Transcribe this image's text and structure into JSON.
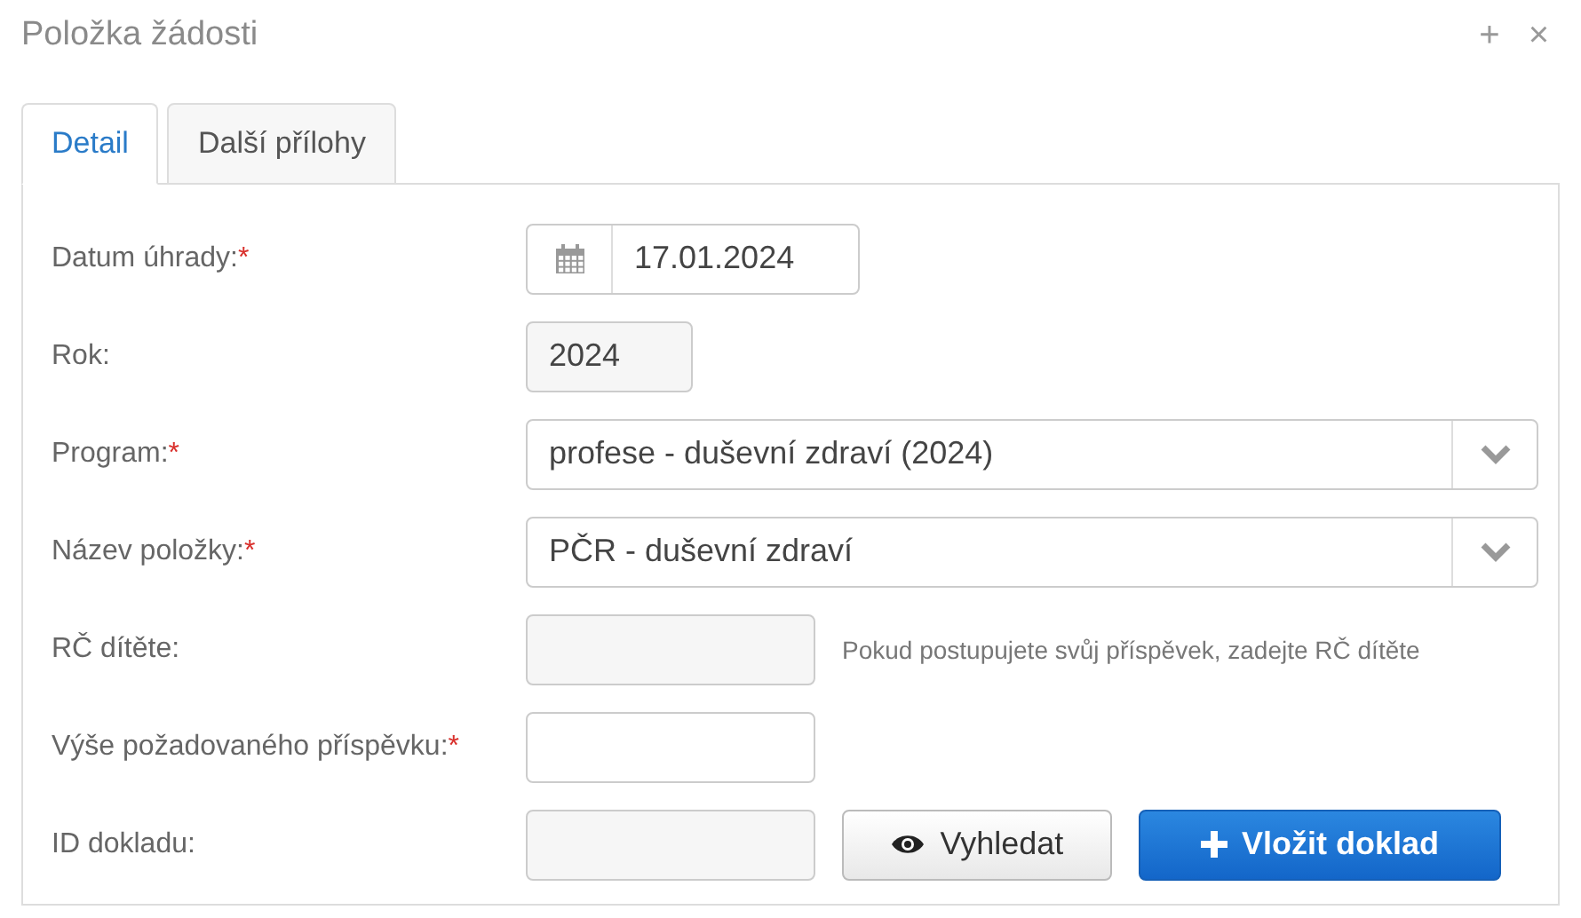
{
  "window": {
    "title": "Položka žádosti",
    "controls": [
      "+",
      "×"
    ]
  },
  "tabs": [
    {
      "label": "Detail",
      "selected": true
    },
    {
      "label": "Další přílohy",
      "selected": false
    }
  ],
  "form": [
    {
      "kind": "date",
      "label": "Datum úhrady:",
      "required_mark": "*",
      "value": "17.01.2024"
    },
    {
      "kind": "year",
      "label": "Rok:",
      "value": "2024"
    },
    {
      "kind": "select",
      "label": "Program:",
      "required_mark": "*",
      "value": "profese - duševní zdraví (2024)"
    },
    {
      "kind": "select",
      "label": "Název položky:",
      "required_mark": "*",
      "value": "PČR - duševní zdraví"
    },
    {
      "kind": "readonly",
      "label": "RČ dítěte:",
      "hint": "Pokud postupujete svůj příspěvek, zadejte RČ dítěte"
    },
    {
      "kind": "text",
      "label": "Výše požadovaného příspěvku:",
      "required_mark": "*"
    },
    {
      "kind": "readonly",
      "label": "ID dokladu:",
      "buttons": [
        {
          "kind": "default",
          "label": "Vyhledat"
        },
        {
          "kind": "primary",
          "label": "Vložit doklad"
        }
      ]
    }
  ]
}
